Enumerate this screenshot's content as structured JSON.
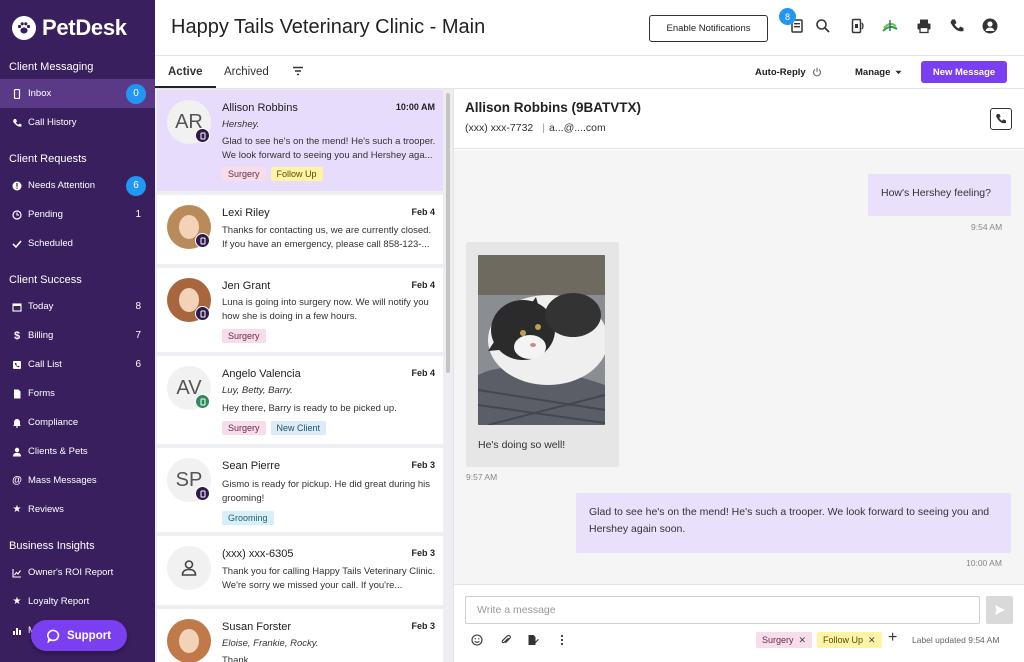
{
  "brand": {
    "name": "PetDesk"
  },
  "sidebar": {
    "sections": [
      {
        "title": "Client Messaging",
        "items": [
          {
            "label": "Inbox",
            "badge": "0",
            "active": true
          },
          {
            "label": "Call History"
          }
        ]
      },
      {
        "title": "Client Requests",
        "items": [
          {
            "label": "Needs Attention",
            "badge": "6"
          },
          {
            "label": "Pending",
            "count": "1"
          },
          {
            "label": "Scheduled"
          }
        ]
      },
      {
        "title": "Client Success",
        "items": [
          {
            "label": "Today",
            "count": "8"
          },
          {
            "label": "Billing",
            "count": "7"
          },
          {
            "label": "Call List",
            "count": "6"
          },
          {
            "label": "Forms"
          },
          {
            "label": "Compliance"
          },
          {
            "label": "Clients & Pets"
          },
          {
            "label": "Mass Messages"
          },
          {
            "label": "Reviews"
          }
        ]
      },
      {
        "title": "Business Insights",
        "items": [
          {
            "label": "Owner's ROI Report"
          },
          {
            "label": "Loyalty Report"
          },
          {
            "label": "M"
          }
        ]
      }
    ],
    "support_label": "Support"
  },
  "header": {
    "title": "Happy Tails Veterinary Clinic - Main",
    "enable_notifications": "Enable Notifications",
    "notification_badge": "8"
  },
  "tabs": {
    "active": "Active",
    "archived": "Archived",
    "auto_reply": "Auto-Reply",
    "manage": "Manage",
    "new_message": "New Message"
  },
  "conversations": [
    {
      "initials": "AR",
      "name": "Allison Robbins",
      "date": "10:00 AM",
      "pets": "Hershey.",
      "preview": "Glad to see he's on the mend! He's such a trooper. We look forward to seeing you and Hershey aga...",
      "tags": [
        "Surgery",
        "Follow Up"
      ]
    },
    {
      "initials": "",
      "name": "Lexi Riley",
      "date": "Feb 4",
      "pets": "",
      "preview": "Thanks for contacting us, we are currently closed. If you have an emergency, please call 858-123-...",
      "tags": []
    },
    {
      "initials": "",
      "name": "Jen Grant",
      "date": "Feb 4",
      "pets": "",
      "preview": "Luna is going into surgery now. We will notify you how she is doing in a few hours.",
      "tags": [
        "Surgery"
      ]
    },
    {
      "initials": "AV",
      "name": "Angelo Valencia",
      "date": "Feb 4",
      "pets": "Luy, Betty, Barry.",
      "preview": "Hey there, Barry is ready to be picked up.",
      "tags": [
        "Surgery",
        "New Client"
      ]
    },
    {
      "initials": "SP",
      "name": "Sean Pierre",
      "date": "Feb 3",
      "pets": "",
      "preview": "Gismo is ready for pickup. He did great during his grooming!",
      "tags": [
        "Grooming"
      ]
    },
    {
      "initials": "",
      "name": "(xxx) xxx-6305",
      "date": "Feb 3",
      "pets": "",
      "preview": "Thank you for calling Happy Tails Veterinary Clinic. We're sorry we missed your call. If you're...",
      "tags": []
    },
    {
      "initials": "",
      "name": "Susan Forster",
      "date": "Feb 3",
      "pets": "Eloise, Frankie, Rocky.",
      "preview": "Thank...",
      "tags": []
    }
  ],
  "chat": {
    "name": "Allison Robbins (9BATVTX)",
    "phone": "(xxx) xxx-7732",
    "separator": "|",
    "email": "a...@....com",
    "messages": [
      {
        "direction": "out",
        "text": "How's Hershey feeling?",
        "time": "9:54 AM"
      },
      {
        "direction": "in",
        "text": "He's doing so well!",
        "time": "9:57 AM",
        "has_image": true
      },
      {
        "direction": "out",
        "text": "Glad to see he's on the mend! He's such a trooper. We look forward to seeing you and Hershey again soon.",
        "time": "10:00 AM"
      }
    ],
    "composer_placeholder": "Write a message",
    "tags": [
      "Surgery",
      "Follow Up"
    ],
    "label_updated": "Label updated 9:54 AM"
  },
  "colors": {
    "sidebar_bg": "#3a1f5e",
    "accent": "#7b3ff2",
    "badge_blue": "#2196f3",
    "selected_row": "#e7dcfb"
  }
}
